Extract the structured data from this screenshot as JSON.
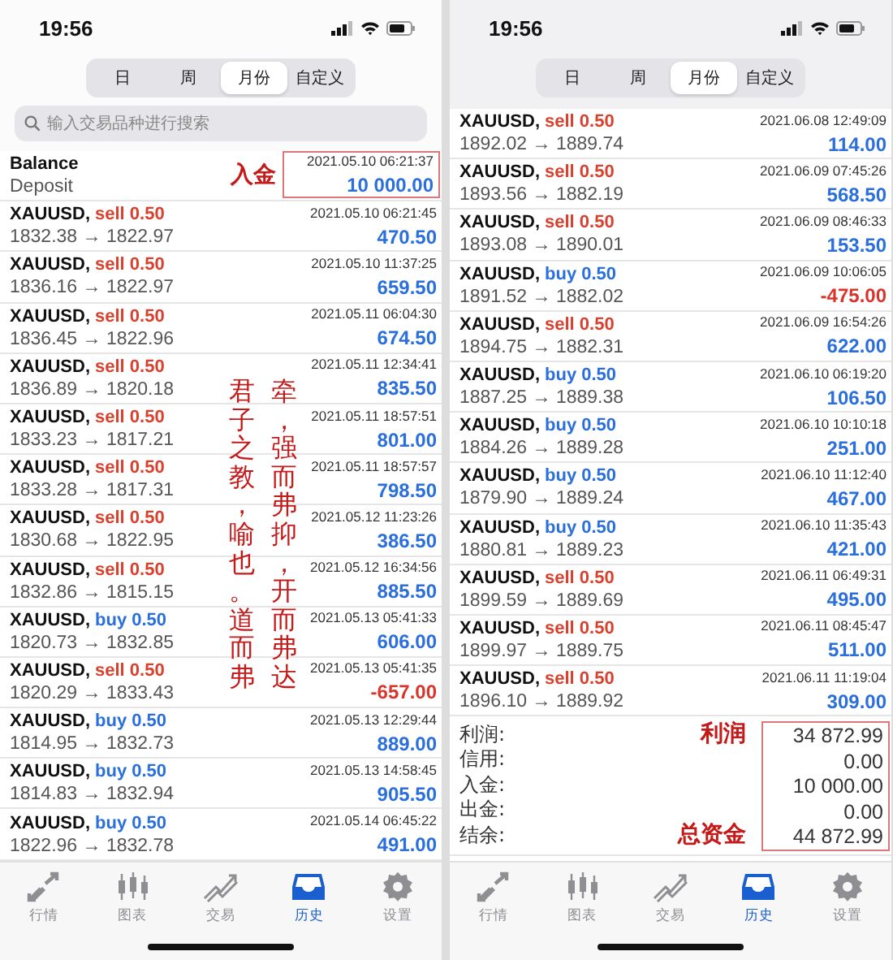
{
  "screens": [
    {
      "status_time": "19:56",
      "periods": [
        {
          "label": "日",
          "selected": false
        },
        {
          "label": "周",
          "selected": false
        },
        {
          "label": "月份",
          "selected": true
        },
        {
          "label": "自定义",
          "selected": false
        }
      ],
      "search": {
        "placeholder": "输入交易品种进行搜索"
      },
      "rows": [
        {
          "kind": "balance",
          "title": "Balance",
          "subtitle": "Deposit",
          "time": "2021.05.10 06:21:37",
          "amount": "10 000.00",
          "loss": false,
          "note": "入金",
          "framed": true
        },
        {
          "kind": "trade",
          "symbol": "XAUUSD,",
          "side": "sell",
          "volume": "0.50",
          "color": "#d9412f",
          "prices": "1832.38 → 1822.97",
          "time": "2021.05.10 06:21:45",
          "amount": "470.50",
          "loss": false
        },
        {
          "kind": "trade",
          "symbol": "XAUUSD,",
          "side": "sell",
          "volume": "0.50",
          "color": "#d9412f",
          "prices": "1836.16 → 1822.97",
          "time": "2021.05.10 11:37:25",
          "amount": "659.50",
          "loss": false
        },
        {
          "kind": "trade",
          "symbol": "XAUUSD,",
          "side": "sell",
          "volume": "0.50",
          "color": "#d9412f",
          "prices": "1836.45 → 1822.96",
          "time": "2021.05.11 06:04:30",
          "amount": "674.50",
          "loss": false
        },
        {
          "kind": "trade",
          "symbol": "XAUUSD,",
          "side": "sell",
          "volume": "0.50",
          "color": "#d9412f",
          "prices": "1836.89 → 1820.18",
          "time": "2021.05.11 12:34:41",
          "amount": "835.50",
          "loss": false
        },
        {
          "kind": "trade",
          "symbol": "XAUUSD,",
          "side": "sell",
          "volume": "0.50",
          "color": "#d9412f",
          "prices": "1833.23 → 1817.21",
          "time": "2021.05.11 18:57:51",
          "amount": "801.00",
          "loss": false
        },
        {
          "kind": "trade",
          "symbol": "XAUUSD,",
          "side": "sell",
          "volume": "0.50",
          "color": "#d9412f",
          "prices": "1833.28 → 1817.31",
          "time": "2021.05.11 18:57:57",
          "amount": "798.50",
          "loss": false
        },
        {
          "kind": "trade",
          "symbol": "XAUUSD,",
          "side": "sell",
          "volume": "0.50",
          "color": "#d9412f",
          "prices": "1830.68 → 1822.95",
          "time": "2021.05.12 11:23:26",
          "amount": "386.50",
          "loss": false
        },
        {
          "kind": "trade",
          "symbol": "XAUUSD,",
          "side": "sell",
          "volume": "0.50",
          "color": "#d9412f",
          "prices": "1832.86 → 1815.15",
          "time": "2021.05.12 16:34:56",
          "amount": "885.50",
          "loss": false
        },
        {
          "kind": "trade",
          "symbol": "XAUUSD,",
          "side": "buy",
          "volume": "0.50",
          "color": "#2a6fdb",
          "prices": "1820.73 → 1832.85",
          "time": "2021.05.13 05:41:33",
          "amount": "606.00",
          "loss": false
        },
        {
          "kind": "trade",
          "symbol": "XAUUSD,",
          "side": "sell",
          "volume": "0.50",
          "color": "#d9412f",
          "prices": "1820.29 → 1833.43",
          "time": "2021.05.13 05:41:35",
          "amount": "-657.00",
          "loss": true
        },
        {
          "kind": "trade",
          "symbol": "XAUUSD,",
          "side": "buy",
          "volume": "0.50",
          "color": "#2a6fdb",
          "prices": "1814.95 → 1832.73",
          "time": "2021.05.13 12:29:44",
          "amount": "889.00",
          "loss": false
        },
        {
          "kind": "trade",
          "symbol": "XAUUSD,",
          "side": "buy",
          "volume": "0.50",
          "color": "#2a6fdb",
          "prices": "1814.83 → 1832.94",
          "time": "2021.05.13 14:58:45",
          "amount": "905.50",
          "loss": false
        },
        {
          "kind": "trade",
          "symbol": "XAUUSD,",
          "side": "buy",
          "volume": "0.50",
          "color": "#2a6fdb",
          "prices": "1822.96 → 1832.78",
          "time": "2021.05.14 06:45:22",
          "amount": "491.00",
          "loss": false
        }
      ],
      "margin_note_columns": [
        "君子之教，喻也。道而弗",
        "牵，强而弗抑，开而弗达"
      ],
      "tabs": [
        {
          "kind": "quotes",
          "label": "行情",
          "selected": false
        },
        {
          "kind": "chart",
          "label": "图表",
          "selected": false
        },
        {
          "kind": "trade",
          "label": "交易",
          "selected": false
        },
        {
          "kind": "history",
          "label": "历史",
          "selected": true
        },
        {
          "kind": "settings",
          "label": "设置",
          "selected": false
        }
      ]
    },
    {
      "status_time": "19:56",
      "periods": [
        {
          "label": "日",
          "selected": false
        },
        {
          "label": "周",
          "selected": false
        },
        {
          "label": "月份",
          "selected": true
        },
        {
          "label": "自定义",
          "selected": false
        }
      ],
      "rows": [
        {
          "kind": "trade",
          "symbol": "XAUUSD,",
          "side": "sell",
          "volume": "0.50",
          "color": "#d9412f",
          "prices": "1892.02 → 1889.74",
          "time": "2021.06.08 12:49:09",
          "amount": "114.00",
          "loss": false
        },
        {
          "kind": "trade",
          "symbol": "XAUUSD,",
          "side": "sell",
          "volume": "0.50",
          "color": "#d9412f",
          "prices": "1893.56 → 1882.19",
          "time": "2021.06.09 07:45:26",
          "amount": "568.50",
          "loss": false
        },
        {
          "kind": "trade",
          "symbol": "XAUUSD,",
          "side": "sell",
          "volume": "0.50",
          "color": "#d9412f",
          "prices": "1893.08 → 1890.01",
          "time": "2021.06.09 08:46:33",
          "amount": "153.50",
          "loss": false
        },
        {
          "kind": "trade",
          "symbol": "XAUUSD,",
          "side": "buy",
          "volume": "0.50",
          "color": "#2a6fdb",
          "prices": "1891.52 → 1882.02",
          "time": "2021.06.09 10:06:05",
          "amount": "-475.00",
          "loss": true
        },
        {
          "kind": "trade",
          "symbol": "XAUUSD,",
          "side": "sell",
          "volume": "0.50",
          "color": "#d9412f",
          "prices": "1894.75 → 1882.31",
          "time": "2021.06.09 16:54:26",
          "amount": "622.00",
          "loss": false
        },
        {
          "kind": "trade",
          "symbol": "XAUUSD,",
          "side": "buy",
          "volume": "0.50",
          "color": "#2a6fdb",
          "prices": "1887.25 → 1889.38",
          "time": "2021.06.10 06:19:20",
          "amount": "106.50",
          "loss": false
        },
        {
          "kind": "trade",
          "symbol": "XAUUSD,",
          "side": "buy",
          "volume": "0.50",
          "color": "#2a6fdb",
          "prices": "1884.26 → 1889.28",
          "time": "2021.06.10 10:10:18",
          "amount": "251.00",
          "loss": false
        },
        {
          "kind": "trade",
          "symbol": "XAUUSD,",
          "side": "buy",
          "volume": "0.50",
          "color": "#2a6fdb",
          "prices": "1879.90 → 1889.24",
          "time": "2021.06.10 11:12:40",
          "amount": "467.00",
          "loss": false
        },
        {
          "kind": "trade",
          "symbol": "XAUUSD,",
          "side": "buy",
          "volume": "0.50",
          "color": "#2a6fdb",
          "prices": "1880.81 → 1889.23",
          "time": "2021.06.10 11:35:43",
          "amount": "421.00",
          "loss": false
        },
        {
          "kind": "trade",
          "symbol": "XAUUSD,",
          "side": "sell",
          "volume": "0.50",
          "color": "#d9412f",
          "prices": "1899.59 → 1889.69",
          "time": "2021.06.11 06:49:31",
          "amount": "495.00",
          "loss": false
        },
        {
          "kind": "trade",
          "symbol": "XAUUSD,",
          "side": "sell",
          "volume": "0.50",
          "color": "#d9412f",
          "prices": "1899.97 → 1889.75",
          "time": "2021.06.11 08:45:47",
          "amount": "511.00",
          "loss": false
        },
        {
          "kind": "trade",
          "symbol": "XAUUSD,",
          "side": "sell",
          "volume": "0.50",
          "color": "#d9412f",
          "prices": "1896.10 → 1889.92",
          "time": "2021.06.11 11:19:04",
          "amount": "309.00",
          "loss": false
        }
      ],
      "summary": {
        "framed": true,
        "items": [
          {
            "label": "利润:",
            "value": "34 872.99",
            "note": "利润"
          },
          {
            "label": "信用:",
            "value": "0.00"
          },
          {
            "label": "入金:",
            "value": "10 000.00"
          },
          {
            "label": "出金:",
            "value": "0.00"
          },
          {
            "label": "结余:",
            "value": "44 872.99",
            "note": "总资金"
          }
        ]
      },
      "tabs": [
        {
          "kind": "quotes",
          "label": "行情",
          "selected": false
        },
        {
          "kind": "chart",
          "label": "图表",
          "selected": false
        },
        {
          "kind": "trade",
          "label": "交易",
          "selected": false
        },
        {
          "kind": "history",
          "label": "历史",
          "selected": true
        },
        {
          "kind": "settings",
          "label": "设置",
          "selected": false
        }
      ]
    }
  ]
}
